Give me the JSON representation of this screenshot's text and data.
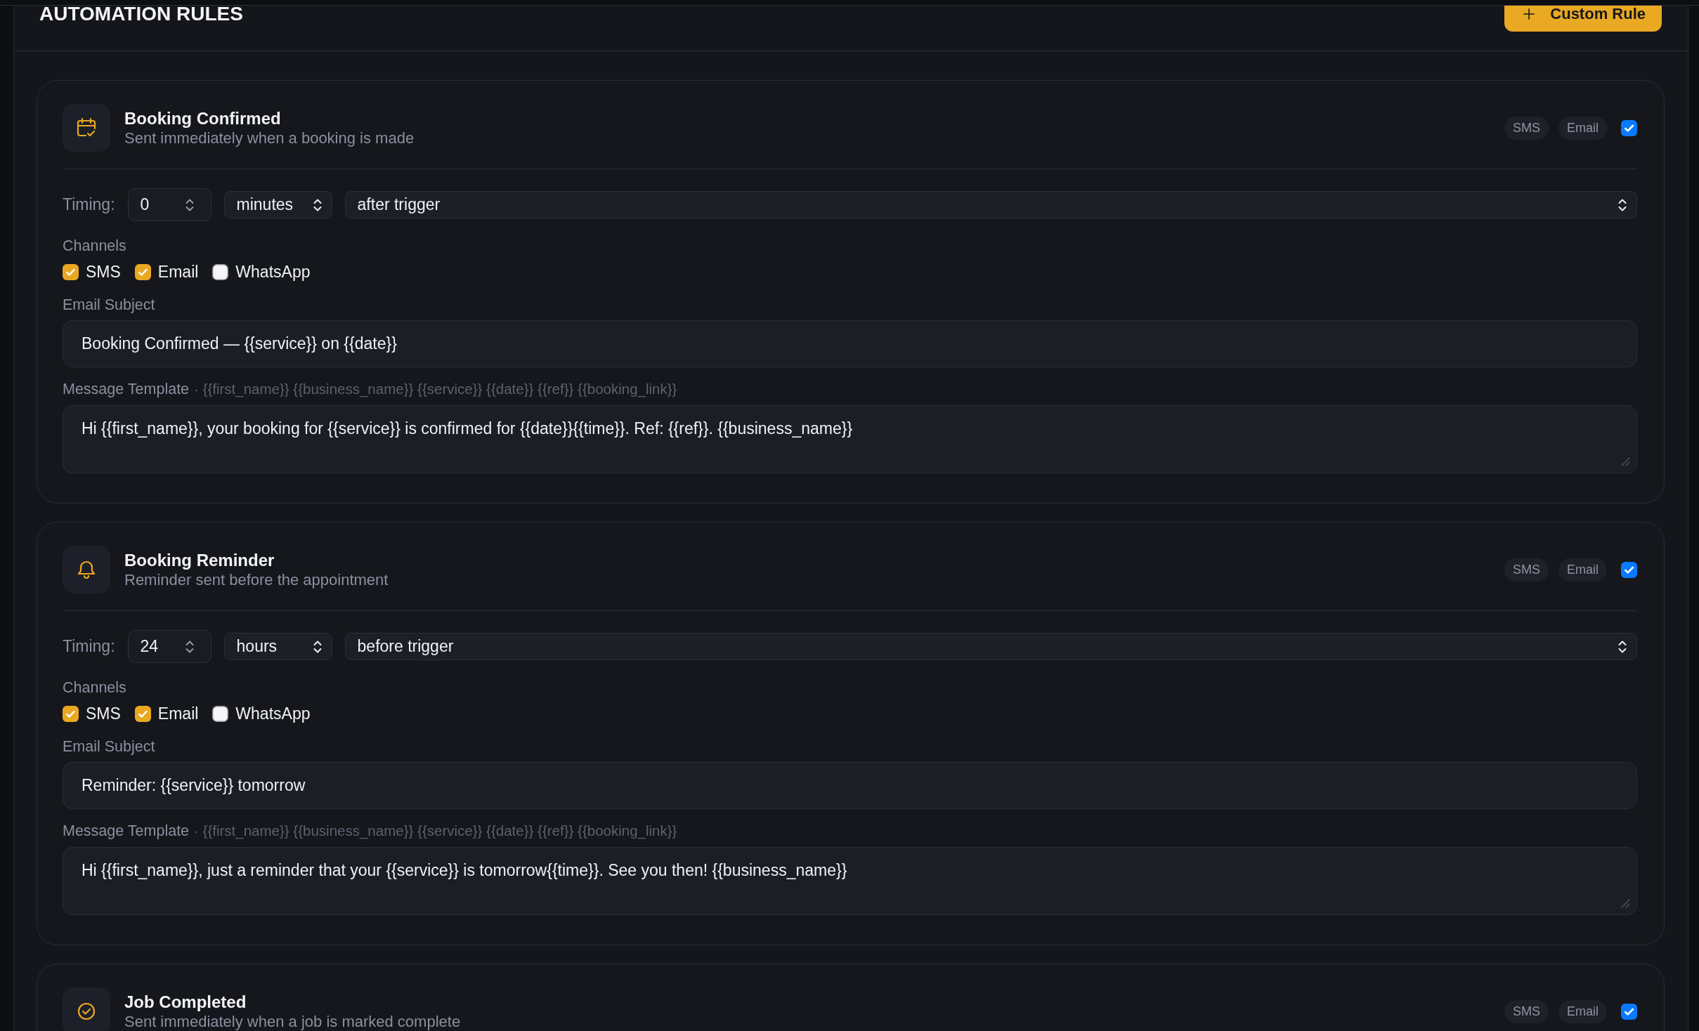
{
  "header": {
    "title": "AUTOMATION RULES",
    "button": "Custom Rule"
  },
  "rules": [
    {
      "title": "Booking Confirmed",
      "description": "Sent immediately when a booking is made",
      "channel_tags": [
        "SMS",
        "Email"
      ],
      "enabled": true,
      "timing": {
        "label": "Timing:",
        "amount": "0",
        "unit": "minutes",
        "relation": "after trigger"
      },
      "channels": {
        "label": "Channels",
        "options": [
          {
            "label": "SMS",
            "checked": true
          },
          {
            "label": "Email",
            "checked": true
          },
          {
            "label": "WhatsApp",
            "checked": false
          }
        ]
      },
      "email_subject": {
        "label": "Email Subject",
        "value": "Booking Confirmed — {{service}} on {{date}}"
      },
      "message_template": {
        "label": "Message Template",
        "hint": "· {{first_name}} {{business_name}} {{service}} {{date}} {{ref}} {{booking_link}}",
        "value": "Hi {{first_name}}, your booking for {{service}} is confirmed for {{date}}{{time}}. Ref: {{ref}}. {{business_name}}"
      }
    },
    {
      "title": "Booking Reminder",
      "description": "Reminder sent before the appointment",
      "channel_tags": [
        "SMS",
        "Email"
      ],
      "enabled": true,
      "timing": {
        "label": "Timing:",
        "amount": "24",
        "unit": "hours",
        "relation": "before trigger"
      },
      "channels": {
        "label": "Channels",
        "options": [
          {
            "label": "SMS",
            "checked": true
          },
          {
            "label": "Email",
            "checked": true
          },
          {
            "label": "WhatsApp",
            "checked": false
          }
        ]
      },
      "email_subject": {
        "label": "Email Subject",
        "value": "Reminder: {{service}} tomorrow"
      },
      "message_template": {
        "label": "Message Template",
        "hint": "· {{first_name}} {{business_name}} {{service}} {{date}} {{ref}} {{booking_link}}",
        "value": "Hi {{first_name}}, just a reminder that your {{service}} is tomorrow{{time}}. See you then! {{business_name}}"
      }
    },
    {
      "title": "Job Completed",
      "description": "Sent immediately when a job is marked complete",
      "channel_tags": [
        "SMS",
        "Email"
      ],
      "enabled": true
    }
  ]
}
